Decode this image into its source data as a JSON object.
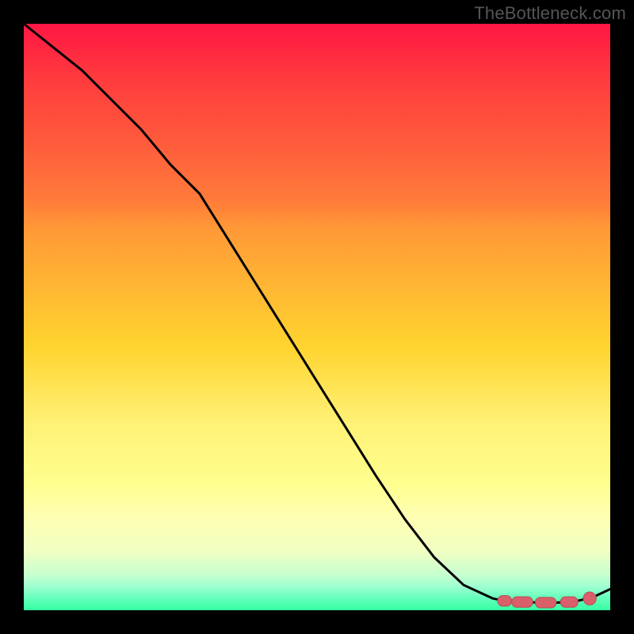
{
  "watermark": "TheBottleneck.com",
  "colors": {
    "background": "#000000",
    "line": "#000000",
    "marker_main": "#d9606b",
    "marker_edge": "#b84a55",
    "gradient_top": "#ff1744",
    "gradient_bottom": "#34ffa1"
  },
  "chart_data": {
    "type": "line",
    "title": "",
    "xlabel": "",
    "ylabel": "",
    "xlim": [
      0,
      100
    ],
    "ylim": [
      0,
      100
    ],
    "axes_visible": false,
    "grid": false,
    "series": [
      {
        "name": "curve",
        "x": [
          0,
          5,
          10,
          15,
          20,
          25,
          30,
          35,
          40,
          45,
          50,
          55,
          60,
          65,
          70,
          75,
          80,
          82,
          85,
          88,
          91,
          94,
          97,
          100
        ],
        "y": [
          100,
          96,
          92,
          87,
          82,
          76,
          71,
          63,
          55,
          47,
          39,
          31,
          23,
          15.5,
          9,
          4.3,
          2,
          1.6,
          1.4,
          1.3,
          1.3,
          1.5,
          2.2,
          3.6
        ]
      }
    ],
    "markers": [
      {
        "shape": "pill",
        "cx": 82.0,
        "cy": 1.6,
        "rx": 1.2,
        "ry": 0.9
      },
      {
        "shape": "pill",
        "cx": 85.0,
        "cy": 1.4,
        "rx": 1.8,
        "ry": 0.9
      },
      {
        "shape": "pill",
        "cx": 89.0,
        "cy": 1.3,
        "rx": 1.8,
        "ry": 0.9
      },
      {
        "shape": "pill",
        "cx": 93.0,
        "cy": 1.4,
        "rx": 1.5,
        "ry": 0.9
      },
      {
        "shape": "dot",
        "cx": 96.5,
        "cy": 2.0,
        "r": 1.1
      }
    ]
  }
}
